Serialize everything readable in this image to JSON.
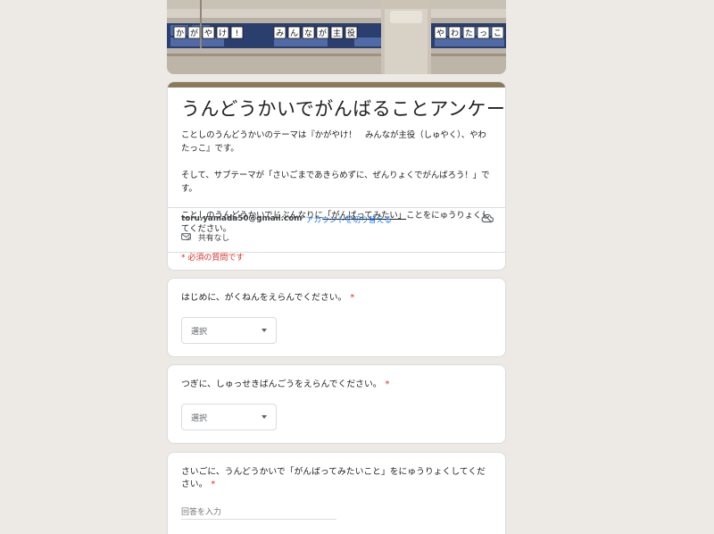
{
  "banner": {
    "sign_chars_left": [
      "か",
      "が",
      "や",
      "け",
      "!"
    ],
    "sign_chars_mid": [
      "み",
      "ん",
      "な",
      "が",
      "主",
      "役"
    ],
    "sign_chars_right": [
      "や",
      "わ",
      "た",
      "っ",
      "こ"
    ]
  },
  "form": {
    "title": "うんどうかいでがんばることアンケート",
    "description": {
      "p1": "ことしのうんどうかいのテーマは『かがやけ！　みんなが主役（しゅやく）、やわたっこ』です。",
      "p2": "そして、サブテーマが「さいごまであきらめずに、ぜんりょくでがんばろう！」です。",
      "p3_before": "ことしのうんどうかいでじぶんなりに",
      "p3_underline": "「がんばってみたい」",
      "p3_after": "ことをにゅうりょくしてください。"
    },
    "account": {
      "email": "toru.yamada50@gmail.com",
      "switch_label": "アカウントを切り替える",
      "share_status": "共有なし"
    },
    "required_note": "* 必須の質問です"
  },
  "questions": [
    {
      "text": "はじめに、がくねんをえらんでください。",
      "required": "*",
      "select_label": "選択"
    },
    {
      "text": "つぎに、しゅっせきばんごうをえらんでください。",
      "required": "*",
      "select_label": "選択"
    },
    {
      "text": "さいごに、うんどうかいで「がんばってみたいこと」をにゅうりょくしてください。",
      "required": "*",
      "answer_placeholder": "回答を入力"
    }
  ],
  "colors": {
    "theme_bar": "#8b7a5a",
    "required": "#d93025",
    "link": "#1a73e8",
    "background": "#ede9e4"
  }
}
